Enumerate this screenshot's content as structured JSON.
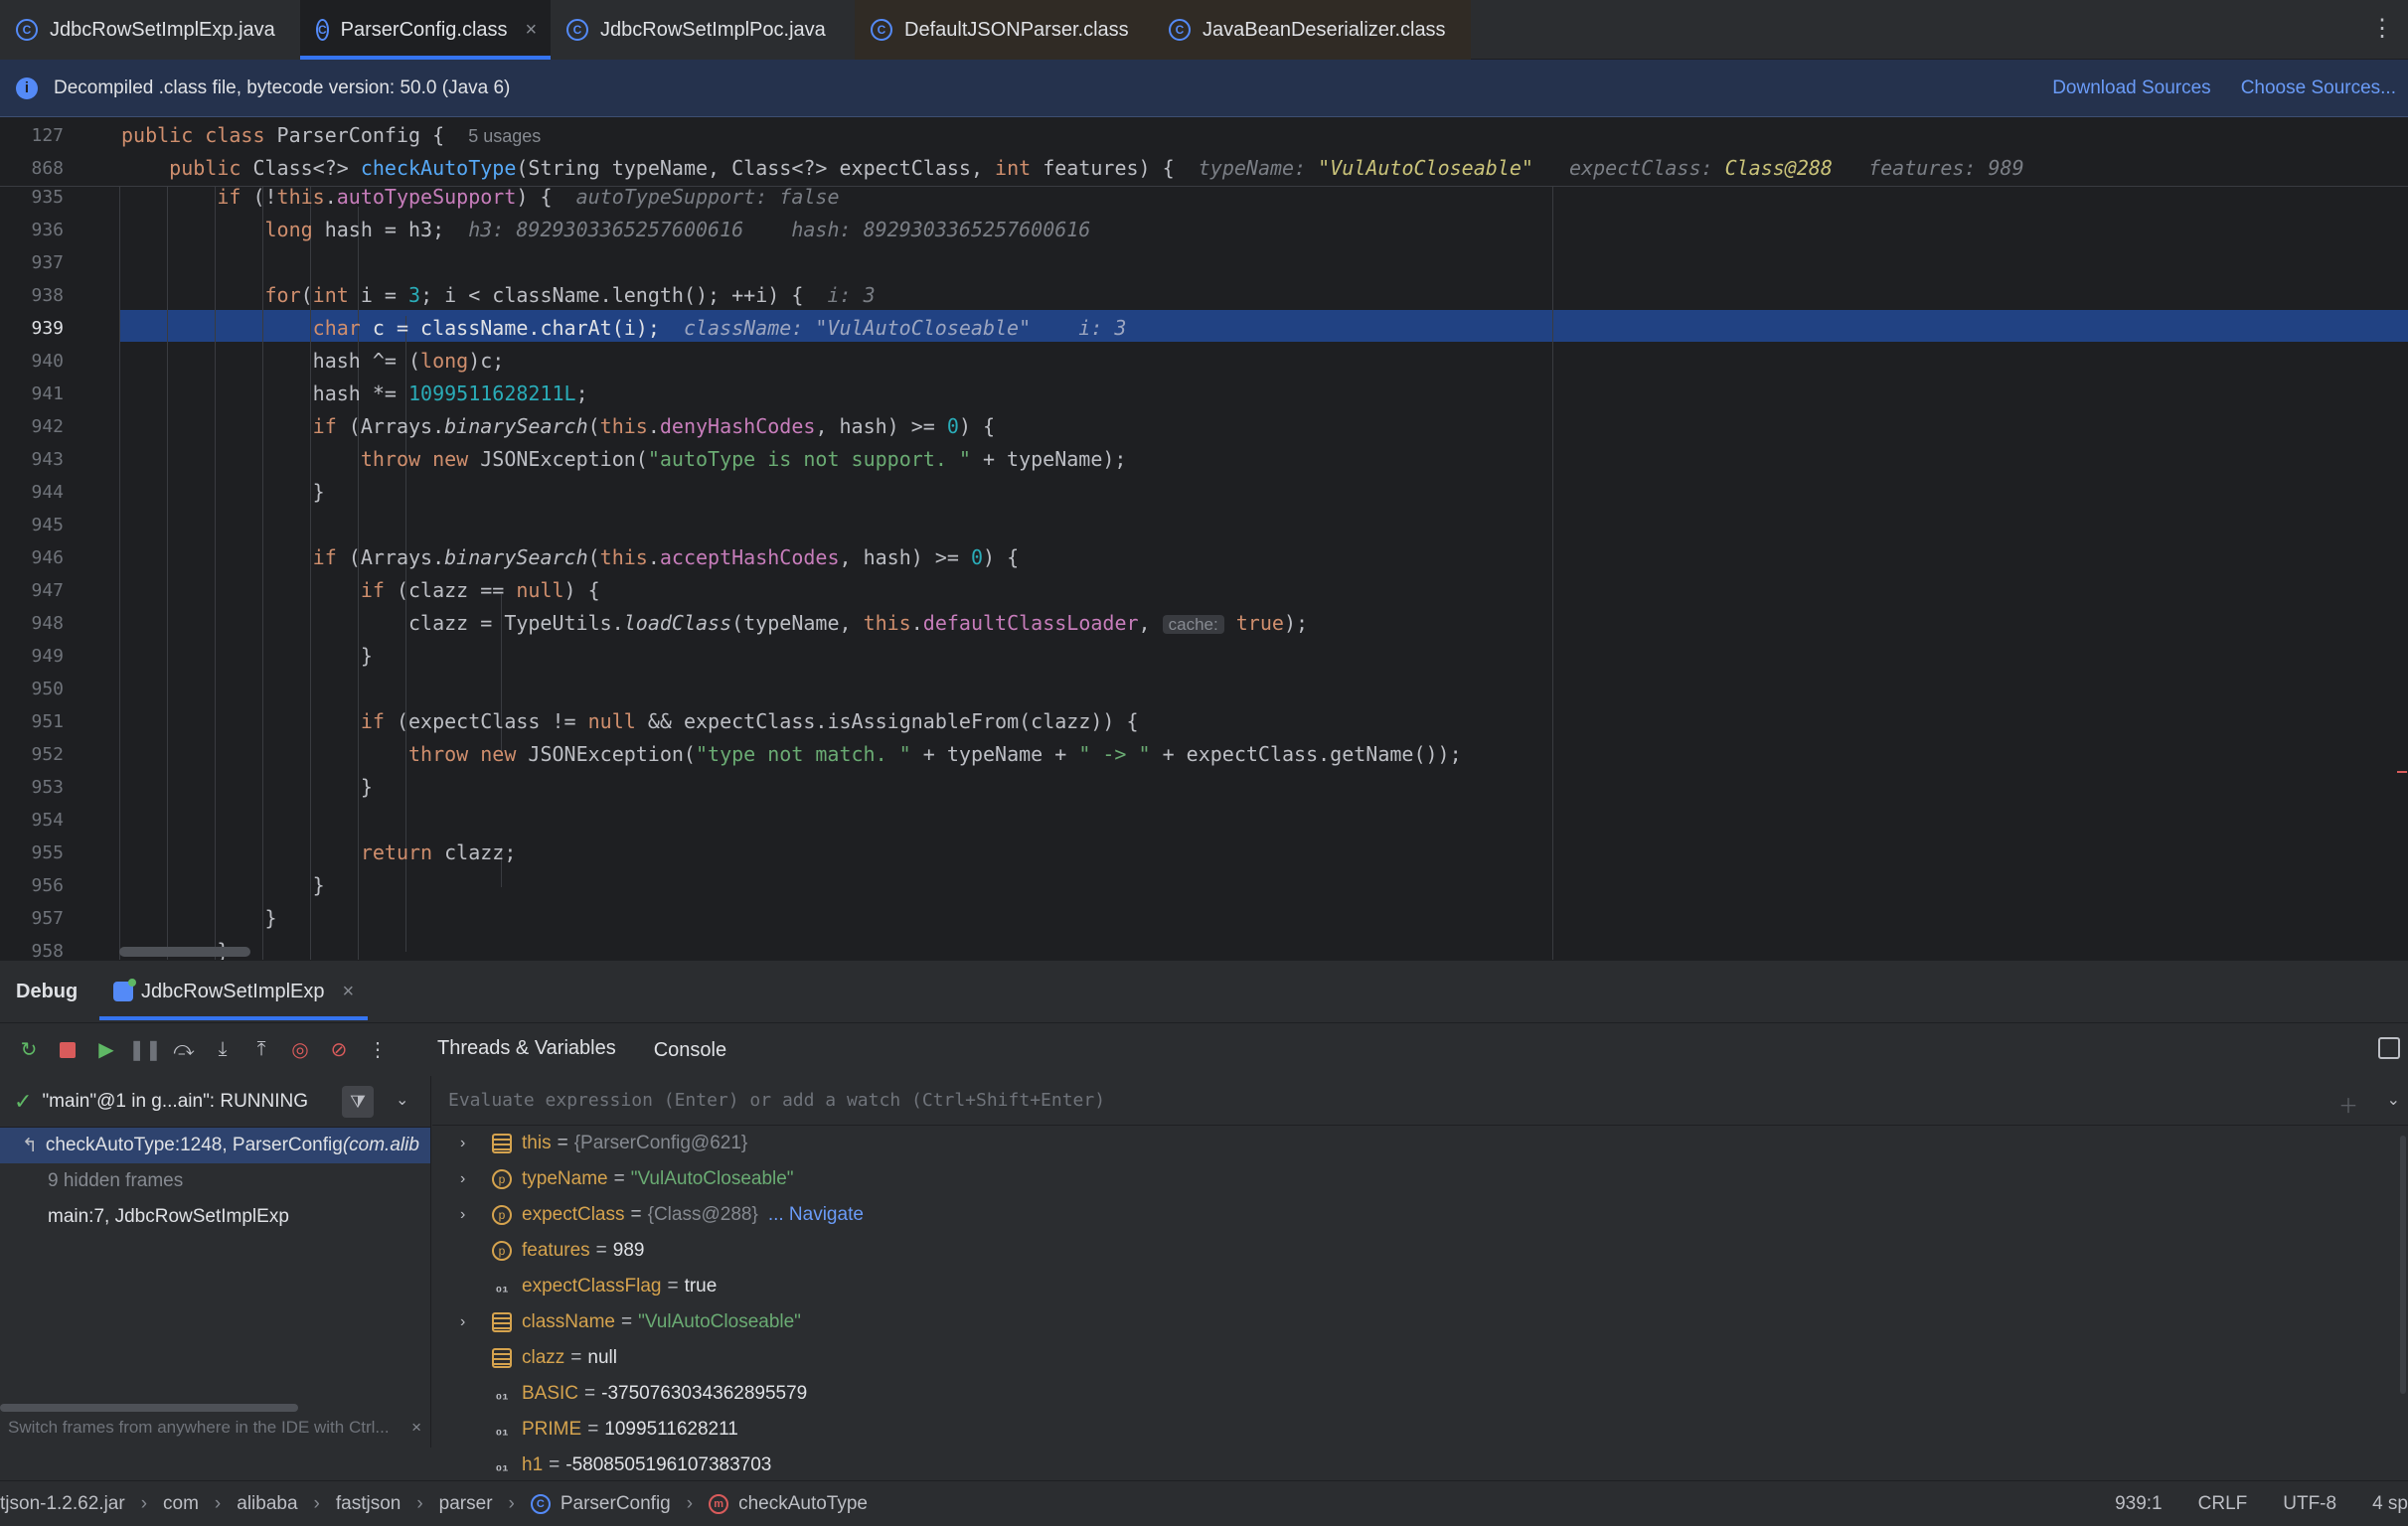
{
  "tabs": [
    {
      "label": "JdbcRowSetImplExp.java",
      "kind": "java",
      "active": false,
      "closable": false
    },
    {
      "label": "ParserConfig.class",
      "kind": "class",
      "active": true,
      "closable": true
    },
    {
      "label": "JdbcRowSetImplPoc.java",
      "kind": "java",
      "active": false,
      "closable": false
    },
    {
      "label": "DefaultJSONParser.class",
      "kind": "class",
      "active": false,
      "closable": false
    },
    {
      "label": "JavaBeanDeserializer.class",
      "kind": "class",
      "active": false,
      "closable": false
    }
  ],
  "banner": {
    "message": "Decompiled .class file, bytecode version: 50.0 (Java 6)",
    "download_sources": "Download Sources",
    "choose_sources": "Choose Sources..."
  },
  "editor": {
    "sticky": [
      {
        "num": "127",
        "usages": "5 usages"
      },
      {
        "num": "868",
        "hint_typeName": "typeName: ",
        "hint_typeName_val": "\"VulAutoCloseable\"",
        "hint_expectClass": "expectClass: ",
        "hint_expectClass_val": "Class@288",
        "hint_features": "features: 989"
      }
    ],
    "line_numbers": [
      "935",
      "936",
      "937",
      "938",
      "939",
      "940",
      "941",
      "942",
      "943",
      "944",
      "945",
      "946",
      "947",
      "948",
      "949",
      "950",
      "951",
      "952",
      "953",
      "954",
      "955",
      "956",
      "957",
      "958"
    ],
    "hints": {
      "l935": "autoTypeSupport: false",
      "l936": "h3: 8929303365257600616    hash: 8929303365257600616",
      "l938": "i: 3",
      "l939": "className: \"VulAutoCloseable\"    i: 3",
      "l948_param": "cache:"
    }
  },
  "debug": {
    "title": "Debug",
    "session_tab": "JdbcRowSetImplExp",
    "subtabs": [
      "Threads & Variables",
      "Console"
    ],
    "thread": "\"main\"@1 in g...ain\": RUNNING",
    "frames": [
      {
        "label": "checkAutoType:1248, ParserConfig ",
        "pkg": "(com.alib",
        "selected": true
      },
      {
        "label": "9 hidden frames",
        "hidden": true
      },
      {
        "label": "main:7, JdbcRowSetImplExp",
        "selected": false
      }
    ],
    "frames_hint": "Switch frames from anywhere in the IDE with Ctrl...",
    "eval_placeholder": "Evaluate expression (Enter) or add a watch (Ctrl+Shift+Enter)",
    "variables": [
      {
        "icon": "field",
        "expandable": true,
        "name": "this",
        "value": "{ParserConfig@621}",
        "vtype": "obj"
      },
      {
        "icon": "param",
        "expandable": true,
        "name": "typeName",
        "value": "\"VulAutoCloseable\"",
        "vtype": "str"
      },
      {
        "icon": "param",
        "expandable": true,
        "name": "expectClass",
        "value": "{Class@288}",
        "vtype": "obj",
        "navigate": "... Navigate"
      },
      {
        "icon": "param",
        "expandable": false,
        "name": "features",
        "value": "989",
        "vtype": "plain"
      },
      {
        "icon": "const",
        "expandable": false,
        "name": "expectClassFlag",
        "value": "true",
        "vtype": "plain"
      },
      {
        "icon": "field",
        "expandable": true,
        "name": "className",
        "value": "\"VulAutoCloseable\"",
        "vtype": "str"
      },
      {
        "icon": "field",
        "expandable": false,
        "name": "clazz",
        "value": "null",
        "vtype": "plain"
      },
      {
        "icon": "const",
        "expandable": false,
        "name": "BASIC",
        "value": "-3750763034362895579",
        "vtype": "plain"
      },
      {
        "icon": "const",
        "expandable": false,
        "name": "PRIME",
        "value": "1099511628211",
        "vtype": "plain"
      },
      {
        "icon": "const",
        "expandable": false,
        "name": "h1",
        "value": "-5808505196107383703",
        "vtype": "plain"
      }
    ]
  },
  "statusbar": {
    "crumbs": [
      "tjson-1.2.62.jar",
      "com",
      "alibaba",
      "fastjson",
      "parser",
      "ParserConfig",
      "checkAutoType"
    ],
    "position": "939:1",
    "line_sep": "CRLF",
    "encoding": "UTF-8",
    "indent": "4 sp"
  },
  "colors": {
    "accent": "#3574f0",
    "exec_line": "#214283",
    "keyword": "#cf8e6d",
    "string": "#6aab73",
    "number": "#2aacb8",
    "function": "#56a8f5",
    "field": "#c77dbb"
  },
  "icons": {
    "tab_java": "java-file-icon",
    "tab_class": "class-file-icon",
    "banner": "info-icon",
    "frame_selected": "return-arrow-icon",
    "thread_state": "checkmark-icon",
    "filter": "filter-icon"
  }
}
